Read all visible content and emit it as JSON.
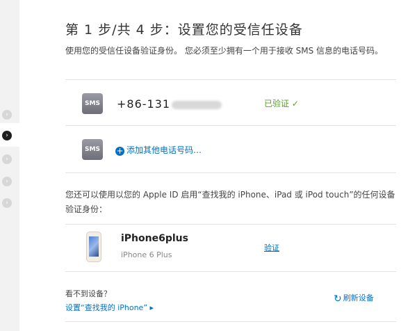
{
  "title": "第 1 步/共 4 步：设置您的受信任设备",
  "intro": "使用您的受信任设备验证身份。 您必须至少拥有一个用于接收 SMS 信息的电话号码。",
  "sms_label": "SMS",
  "phone_prefix": "+86-131",
  "verified_label": "已验证 ✓",
  "add_phone": "添加其他电话号码…",
  "alt_text": "您还可以使用以您的 Apple ID 启用“查找我的 iPhone、iPad 或 iPod touch”的任何设备验证身份：",
  "device": {
    "name": "iPhone6plus",
    "model": "iPhone 6 Plus",
    "verify": "验证"
  },
  "cant_see": "看不到设备？",
  "setup_link": "设置“查找我的 iPhone” ▸",
  "refresh": "刷新设备",
  "colors": {
    "accent": "#0070c9",
    "verified": "#5aa02c"
  },
  "icons": [
    "step-indicator",
    "sms-icon",
    "add-circle-icon",
    "iphone-icon",
    "refresh-icon"
  ]
}
